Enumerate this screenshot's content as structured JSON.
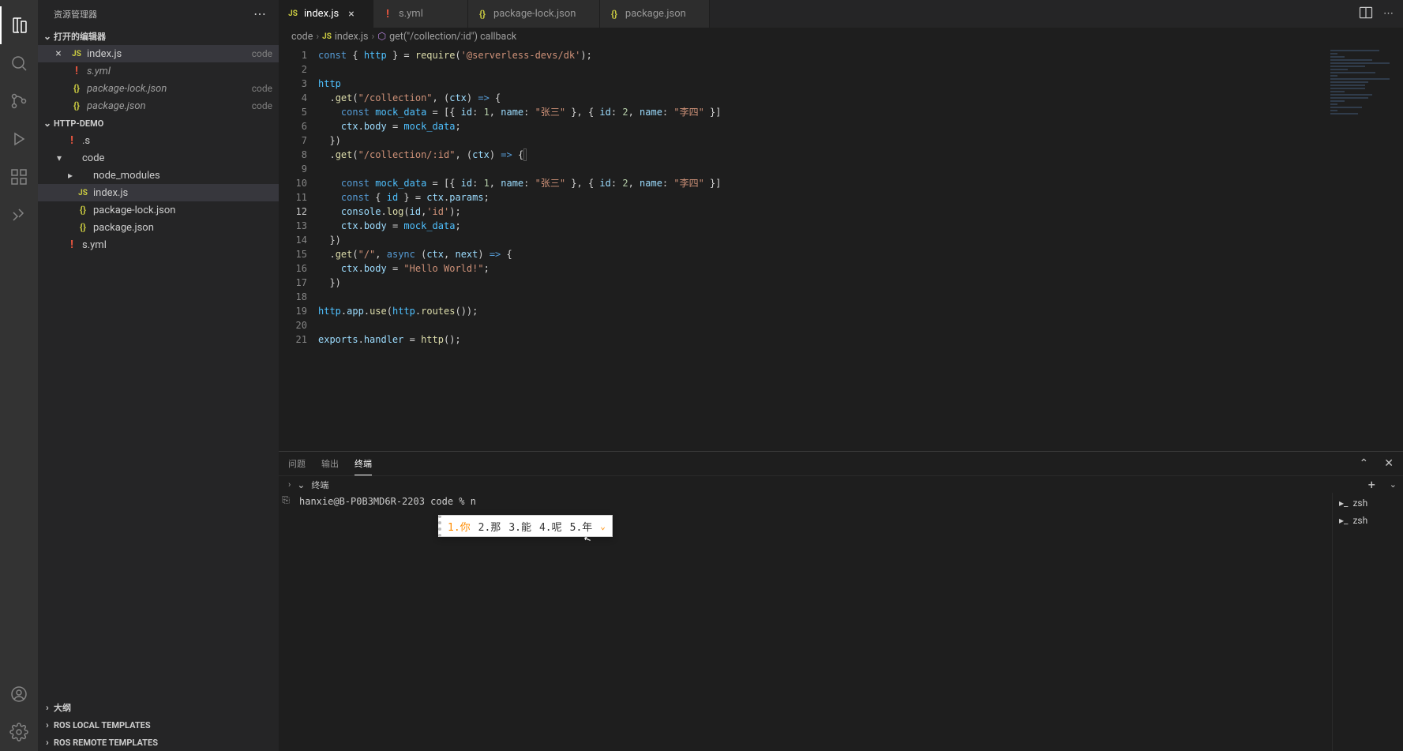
{
  "sidebar": {
    "title": "资源管理器",
    "open_editors_label": "打开的编辑器",
    "open_editors": [
      {
        "name": "index.js",
        "hint": "code",
        "icon": "js",
        "active": true,
        "close": true
      },
      {
        "name": "s.yml",
        "hint": "",
        "icon": "yml",
        "dimmed": true
      },
      {
        "name": "package-lock.json",
        "hint": "code",
        "icon": "json",
        "dimmed": true
      },
      {
        "name": "package.json",
        "hint": "code",
        "icon": "json",
        "dimmed": true
      }
    ],
    "project_label": "HTTP-DEMO",
    "tree": [
      {
        "indent": 1,
        "twisty": "",
        "icon": "yml",
        "name": ".s"
      },
      {
        "indent": 1,
        "twisty": "▾",
        "icon": "",
        "name": "code"
      },
      {
        "indent": 2,
        "twisty": "▸",
        "icon": "",
        "name": "node_modules"
      },
      {
        "indent": 2,
        "twisty": "",
        "icon": "js",
        "name": "index.js",
        "active": true
      },
      {
        "indent": 2,
        "twisty": "",
        "icon": "json",
        "name": "package-lock.json"
      },
      {
        "indent": 2,
        "twisty": "",
        "icon": "json",
        "name": "package.json"
      },
      {
        "indent": 1,
        "twisty": "",
        "icon": "yml",
        "name": "s.yml"
      }
    ],
    "bottom_sections": [
      "大纲",
      "ROS LOCAL TEMPLATES",
      "ROS REMOTE TEMPLATES"
    ]
  },
  "tabs": [
    {
      "icon": "js",
      "label": "index.js",
      "active": true
    },
    {
      "icon": "yml",
      "label": "s.yml"
    },
    {
      "icon": "json",
      "label": "package-lock.json"
    },
    {
      "icon": "json",
      "label": "package.json"
    }
  ],
  "breadcrumb": [
    "code",
    "index.js",
    "get(\"/collection/:id\") callback"
  ],
  "code_lines": 21,
  "current_line": 12,
  "panel": {
    "tabs": [
      "问题",
      "输出",
      "终端"
    ],
    "active": 2,
    "terminal_label": "终端",
    "prompt": "hanxie@B-P0B3MD6R-2203 code % n",
    "shells": [
      "zsh",
      "zsh"
    ]
  },
  "ime": {
    "candidates": [
      "1.你",
      "2.那",
      "3.能",
      "4.呢",
      "5.年"
    ]
  }
}
